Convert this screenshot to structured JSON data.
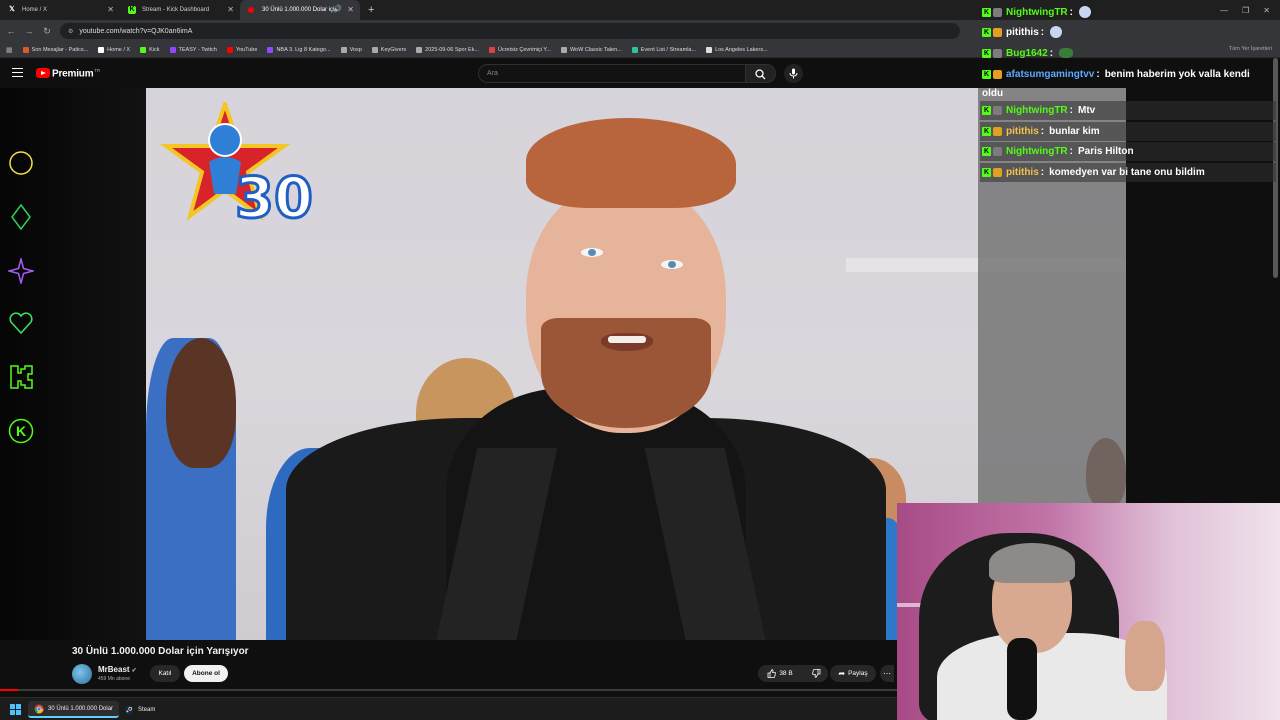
{
  "browser": {
    "tabs": [
      {
        "label": "Home / X",
        "icon": "x-logo-icon",
        "active": false
      },
      {
        "label": "Stream - Kick Dashboard",
        "icon": "kick-logo-icon",
        "active": false
      },
      {
        "label": "30 Ünlü 1.000.000 Dolar için",
        "icon": "youtube-logo-icon",
        "active": true
      }
    ],
    "url": "youtube.com/watch?v=QJK0an6imA",
    "bookmarks": [
      {
        "label": "Son Mesajlar - Patics...",
        "color": "#e0592a"
      },
      {
        "label": "Home / X",
        "color": "#ffffff"
      },
      {
        "label": "Kick",
        "color": "#53fc18"
      },
      {
        "label": "TEASY - Twitch",
        "color": "#9146ff"
      },
      {
        "label": "YouTube",
        "color": "#ff0000"
      },
      {
        "label": "NBA 3. Lig 8 Katego...",
        "color": "#9146ff"
      },
      {
        "label": "Vosp",
        "color": "#aaaaaa"
      },
      {
        "label": "KeyGivers",
        "color": "#aaaaaa"
      },
      {
        "label": "2025-09-06 Spor Ek...",
        "color": "#aaaaaa"
      },
      {
        "label": "Ücretsiz Çevrimiçi Y...",
        "color": "#e04040"
      },
      {
        "label": "WoW Classic Talen...",
        "color": "#aaaaaa"
      },
      {
        "label": "Event List / Streamla...",
        "color": "#2ec4a0"
      },
      {
        "label": "Los Angeles Lakers...",
        "color": "#dddddd"
      }
    ],
    "bookmarks_right": "Tüm Yer İşaretleri"
  },
  "youtube": {
    "brand": "Premium",
    "brand_sup": "TR",
    "search_placeholder": "Ara",
    "video_title": "30 Ünlü 1.000.000 Dolar için Yarışıyor",
    "channel_name": "MrBeast",
    "subscribers": "459 Mn abone",
    "join_label": "Katıl",
    "subscribe_label": "Abone ol",
    "likes": "38 B",
    "share_label": "Paylaş",
    "badge_number": "30",
    "progress_fraction": 0.02
  },
  "chat": [
    {
      "user": "NightwingTR",
      "color": "#53fc18",
      "text": "",
      "emote": "face"
    },
    {
      "user": "pitithis",
      "color": "#ffffff",
      "text": "",
      "emote": "face"
    },
    {
      "user": "Bug1642",
      "color": "#53fc18",
      "text": "",
      "emote": "frog"
    },
    {
      "user": "afatsumgamingtvv",
      "color": "#5fa8ff",
      "text": "benim haberim yok valla kendi",
      "cont": "oldu"
    },
    {
      "user": "NightwingTR",
      "color": "#53fc18",
      "text": "Mtv"
    },
    {
      "user": "pitithis",
      "color": "#f2c14e",
      "text": "bunlar kim"
    },
    {
      "user": "NightwingTR",
      "color": "#53fc18",
      "text": "Paris Hilton"
    },
    {
      "user": "pitithis",
      "color": "#f2c14e",
      "text": "komedyen var bi tane onu bildim"
    }
  ],
  "taskbar": {
    "items": [
      {
        "label": "30 Ünlü 1.000.000 Dolar",
        "icon": "chrome-icon"
      },
      {
        "label": "Steam",
        "icon": "steam-icon"
      }
    ]
  },
  "colors": {
    "kick_green": "#53fc18",
    "youtube_red": "#ff0000"
  }
}
